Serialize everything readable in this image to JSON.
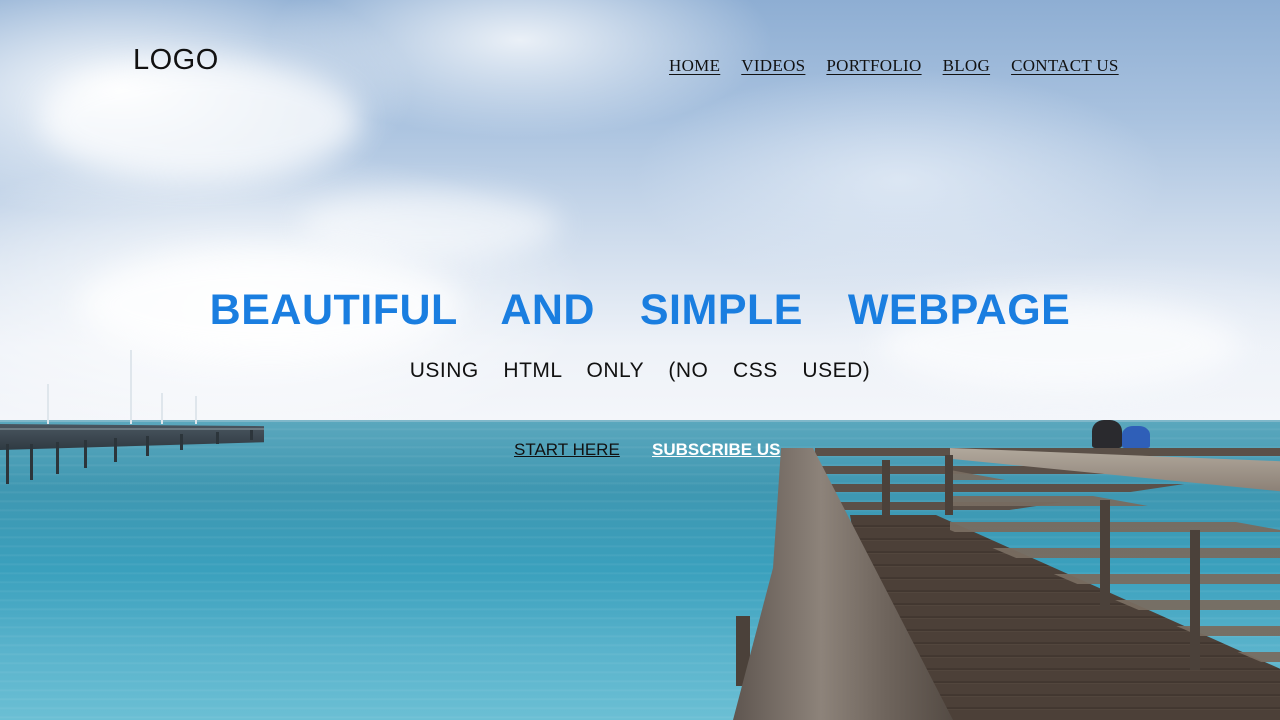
{
  "header": {
    "logo": "LOGO",
    "nav": [
      {
        "label": "HOME"
      },
      {
        "label": "VIDEOS"
      },
      {
        "label": "PORTFOLIO"
      },
      {
        "label": "BLOG"
      },
      {
        "label": "CONTACT US"
      }
    ]
  },
  "hero": {
    "title": "BEAUTIFUL  AND  SIMPLE  WEBPAGE",
    "subtitle": "USING  HTML  ONLY  (NO  CSS  USED)",
    "buttons": {
      "start": "START HERE",
      "subscribe": "SUBSCRIBE US"
    }
  },
  "colors": {
    "title": "#1a7ee0",
    "nav_text": "#111111",
    "subscribe_text": "#ffffff"
  }
}
